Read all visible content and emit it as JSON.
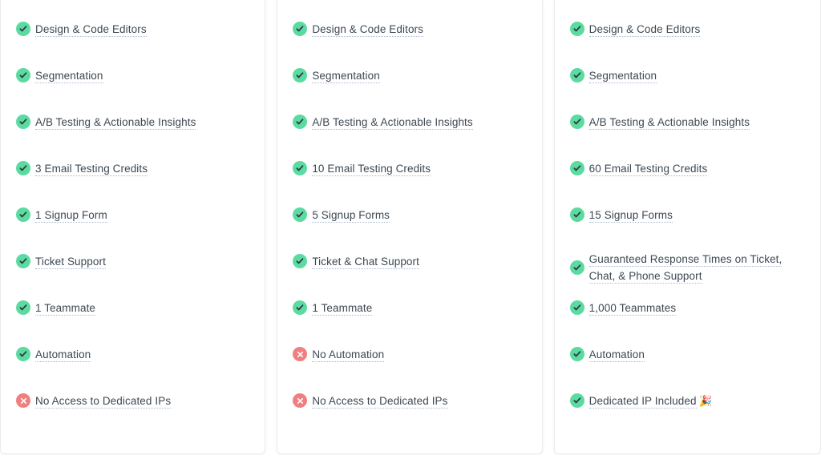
{
  "theme": {
    "page_background": "#ffffff",
    "card_background": "#ffffff",
    "card_border": "#e9ecef",
    "text_color": "#3d4852",
    "underline_color": "#aab7d4",
    "icon_yes_color": "#5cdba1",
    "icon_no_color": "#f08080",
    "icon_glyph_color": "#2d3748"
  },
  "plans": [
    {
      "name": "plan-basic",
      "features": [
        {
          "label": "Design & Code Editors",
          "status": "yes",
          "icon": "check-circle-icon",
          "emoji": ""
        },
        {
          "label": "Segmentation",
          "status": "yes",
          "icon": "check-circle-icon",
          "emoji": ""
        },
        {
          "label": "A/B Testing & Actionable Insights",
          "status": "yes",
          "icon": "check-circle-icon",
          "emoji": ""
        },
        {
          "label": "3 Email Testing Credits",
          "status": "yes",
          "icon": "check-circle-icon",
          "emoji": ""
        },
        {
          "label": "1 Signup Form",
          "status": "yes",
          "icon": "check-circle-icon",
          "emoji": ""
        },
        {
          "label": "Ticket Support",
          "status": "yes",
          "icon": "check-circle-icon",
          "emoji": ""
        },
        {
          "label": "1 Teammate",
          "status": "yes",
          "icon": "check-circle-icon",
          "emoji": ""
        },
        {
          "label": "Automation",
          "status": "yes",
          "icon": "check-circle-icon",
          "emoji": ""
        },
        {
          "label": "No Access to Dedicated IPs",
          "status": "no",
          "icon": "x-circle-icon",
          "emoji": ""
        }
      ]
    },
    {
      "name": "plan-standard",
      "features": [
        {
          "label": "Design & Code Editors",
          "status": "yes",
          "icon": "check-circle-icon",
          "emoji": ""
        },
        {
          "label": "Segmentation",
          "status": "yes",
          "icon": "check-circle-icon",
          "emoji": ""
        },
        {
          "label": "A/B Testing & Actionable Insights",
          "status": "yes",
          "icon": "check-circle-icon",
          "emoji": ""
        },
        {
          "label": "10 Email Testing Credits",
          "status": "yes",
          "icon": "check-circle-icon",
          "emoji": ""
        },
        {
          "label": "5 Signup Forms",
          "status": "yes",
          "icon": "check-circle-icon",
          "emoji": ""
        },
        {
          "label": "Ticket & Chat Support",
          "status": "yes",
          "icon": "check-circle-icon",
          "emoji": ""
        },
        {
          "label": "1 Teammate",
          "status": "yes",
          "icon": "check-circle-icon",
          "emoji": ""
        },
        {
          "label": "No Automation",
          "status": "no",
          "icon": "x-circle-icon",
          "emoji": ""
        },
        {
          "label": "No Access to Dedicated IPs",
          "status": "no",
          "icon": "x-circle-icon",
          "emoji": ""
        }
      ]
    },
    {
      "name": "plan-premium",
      "features": [
        {
          "label": "Design & Code Editors",
          "status": "yes",
          "icon": "check-circle-icon",
          "emoji": ""
        },
        {
          "label": "Segmentation",
          "status": "yes",
          "icon": "check-circle-icon",
          "emoji": ""
        },
        {
          "label": "A/B Testing & Actionable Insights",
          "status": "yes",
          "icon": "check-circle-icon",
          "emoji": ""
        },
        {
          "label": "60 Email Testing Credits",
          "status": "yes",
          "icon": "check-circle-icon",
          "emoji": ""
        },
        {
          "label": "15 Signup Forms",
          "status": "yes",
          "icon": "check-circle-icon",
          "emoji": ""
        },
        {
          "label": "Guaranteed Response Times on Ticket, Chat, & Phone Support",
          "status": "yes",
          "icon": "check-circle-icon",
          "emoji": ""
        },
        {
          "label": "1,000 Teammates",
          "status": "yes",
          "icon": "check-circle-icon",
          "emoji": ""
        },
        {
          "label": "Automation",
          "status": "yes",
          "icon": "check-circle-icon",
          "emoji": ""
        },
        {
          "label": "Dedicated IP Included",
          "status": "yes",
          "icon": "check-circle-icon",
          "emoji": "🎉"
        }
      ]
    }
  ]
}
